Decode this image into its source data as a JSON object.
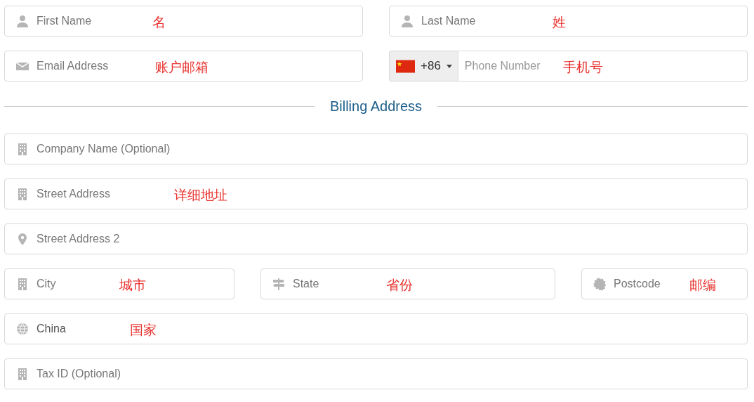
{
  "contact_rows": [
    [
      {
        "kind": "text",
        "placeholder": "First Name",
        "note": "名"
      },
      {
        "kind": "text",
        "placeholder": "Last Name",
        "note": "姓"
      }
    ],
    [
      {
        "kind": "text",
        "placeholder": "Email Address",
        "note": "账户邮箱"
      },
      {
        "kind": "phone",
        "dial_code": "+86",
        "placeholder": "Phone Number",
        "note": "手机号"
      }
    ]
  ],
  "billing": {
    "heading": "Billing Address",
    "rows": [
      [
        {
          "kind": "text",
          "placeholder": "Company Name (Optional)"
        }
      ],
      [
        {
          "kind": "text",
          "placeholder": "Street Address",
          "note": "详细地址"
        }
      ],
      [
        {
          "kind": "text",
          "placeholder": "Street Address 2"
        }
      ],
      [
        {
          "kind": "text",
          "placeholder": "City",
          "note": "城市"
        },
        {
          "kind": "text",
          "placeholder": "State",
          "note": "省份"
        },
        {
          "kind": "text",
          "placeholder": "Postcode",
          "note": "邮编"
        }
      ],
      [
        {
          "kind": "select",
          "value": "China",
          "note": "国家"
        }
      ],
      [
        {
          "kind": "text",
          "placeholder": "Tax ID (Optional)"
        }
      ]
    ]
  }
}
